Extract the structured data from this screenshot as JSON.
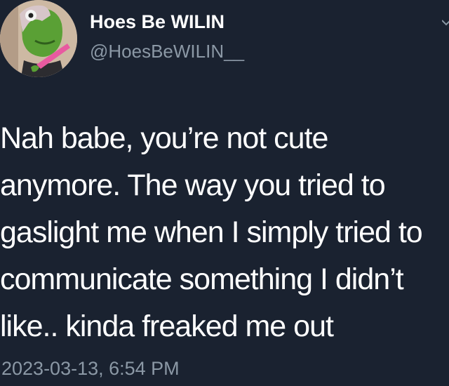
{
  "user": {
    "name": "Hoes Be WILIN",
    "handle": "@HoesBeWILIN__"
  },
  "tweet": {
    "lines": [
      "Nah babe, you’re not cute",
      "anymore. The way you tried to",
      "gaslight me when I simply tried to",
      "communicate something I didn’t",
      "like.. kinda freaked me out"
    ],
    "timestamp": "2023-03-13, 6:54 PM"
  },
  "colors": {
    "background": "#1a2230",
    "text": "#ffffff",
    "secondary": "#8b98a5"
  },
  "icons": {
    "avatar": "kermit-avatar-icon",
    "menu": "chevron-down-icon"
  }
}
